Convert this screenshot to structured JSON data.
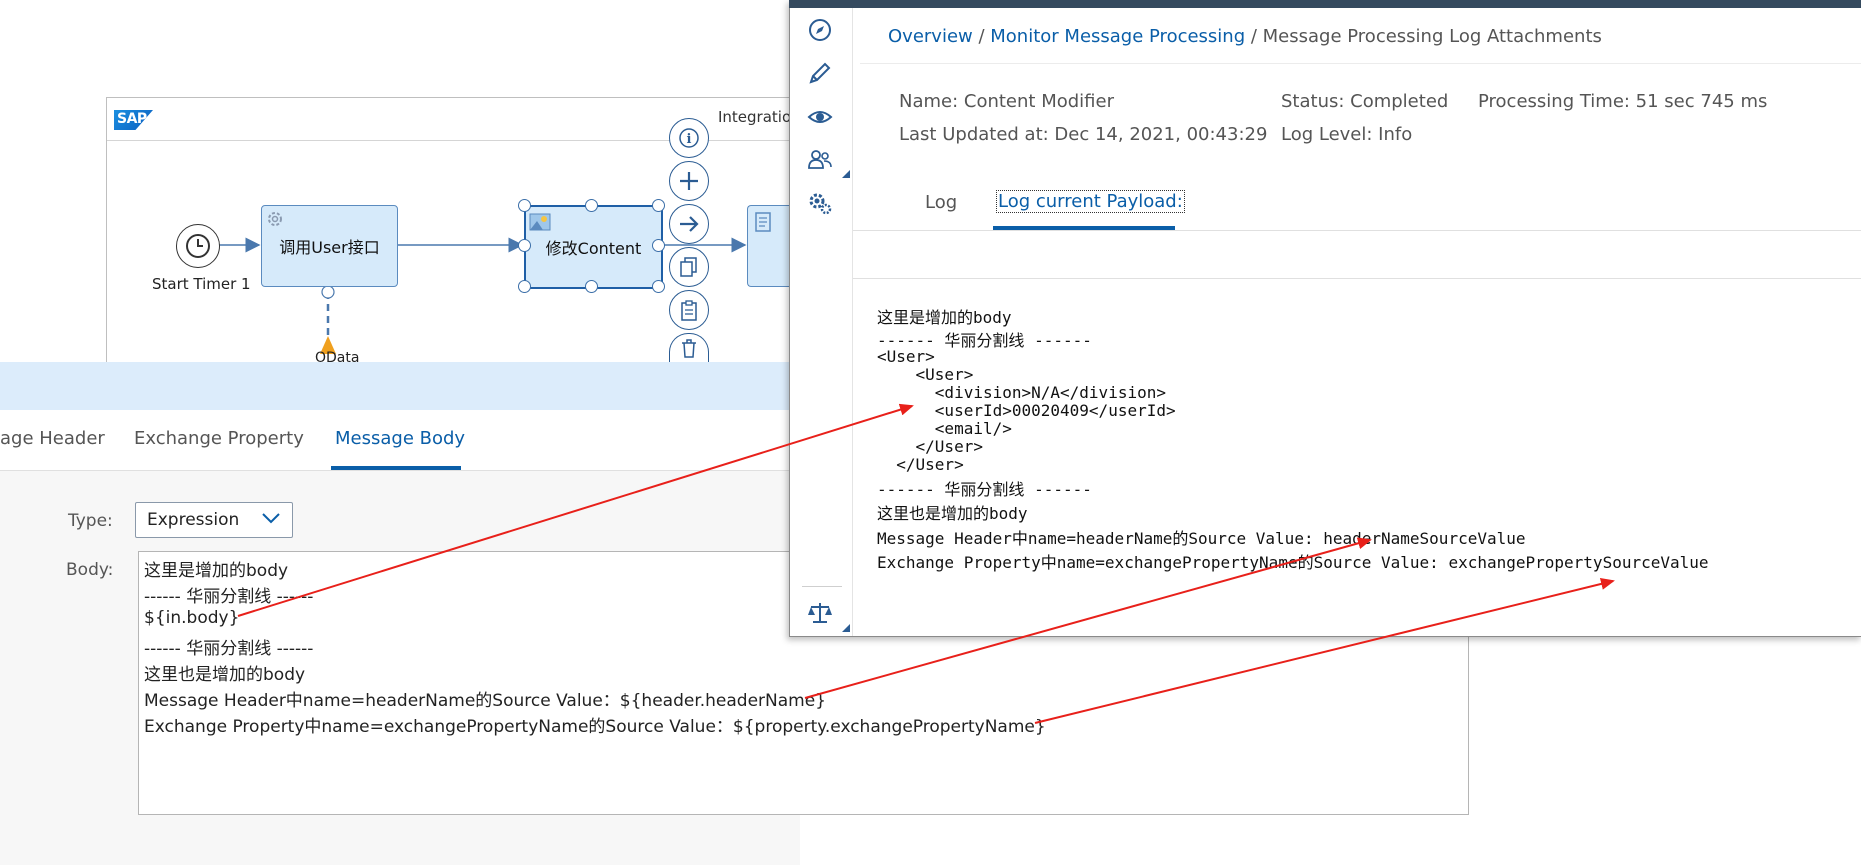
{
  "flow": {
    "logo_text": "SAP",
    "integration_label": "Integration",
    "start_event_label": "Start Timer 1",
    "tasks": {
      "user_call": "调用User接口",
      "modify_content": "修改Content"
    },
    "odata_label": "OData"
  },
  "properties": {
    "tabs": [
      "age Header",
      "Exchange Property",
      "Message Body"
    ],
    "active_tab": "Message Body",
    "type_label": "Type:",
    "type_value": "Expression",
    "body_label": "Body:",
    "body_lines": [
      "这里是增加的body",
      "------ 华丽分割线 ------",
      "${in.body}",
      "------ 华丽分割线 ------",
      "这里也是增加的body",
      "Message Header中name=headerName的Source Value：${header.headerName}",
      "Exchange Property中name=exchangePropertyName的Source Value：${property.exchangePropertyName}"
    ]
  },
  "monitor": {
    "breadcrumb": {
      "overview": "Overview",
      "sep": " / ",
      "monitor": "Monitor Message Processing",
      "current": "Message Processing Log Attachments"
    },
    "meta": {
      "name": "Name: Content Modifier",
      "last_updated": "Last Updated at: Dec 14, 2021, 00:43:29",
      "status": "Status: Completed",
      "log_level": "Log Level: Info",
      "processing_time": "Processing Time: 51 sec 745 ms"
    },
    "tabs": [
      "Log",
      "Log current Payload:"
    ],
    "active_tab": "Log current Payload:",
    "payload_lines": [
      "这里是增加的body",
      "------ 华丽分割线 ------",
      "<User>",
      "    <User>",
      "      <division>N/A</division>",
      "      <userId>00020409</userId>",
      "      <email/>",
      "    </User>",
      "  </User>",
      "------ 华丽分割线 ------",
      "这里也是增加的body",
      "Message Header中name=headerName的Source Value: headerNameSourceValue",
      "Exchange Property中name=exchangePropertyName的Source Value: exchangePropertySourceValue"
    ],
    "sidebar_icons": [
      "compass-icon",
      "pencil-icon",
      "eye-icon",
      "users-icon",
      "gears-icon",
      "scales-icon"
    ]
  },
  "colors": {
    "accent": "#0a5ea8",
    "annotation_arrow": "#e8201a",
    "task_fill": "#d6eafa",
    "panel_bar": "#dcecfb",
    "shell_bar": "#354a5f"
  }
}
